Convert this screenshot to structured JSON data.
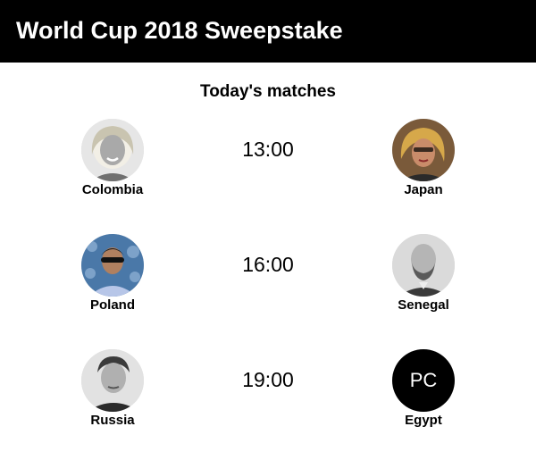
{
  "app": {
    "title": "World Cup 2018 Sweepstake"
  },
  "section": {
    "title": "Today's matches"
  },
  "matches": [
    {
      "time": "13:00",
      "home": {
        "team": "Colombia",
        "avatar": "blonde-woman-photo"
      },
      "away": {
        "team": "Japan",
        "avatar": "woman-red-hair-photo"
      }
    },
    {
      "time": "16:00",
      "home": {
        "team": "Poland",
        "avatar": "man-sunglasses-photo"
      },
      "away": {
        "team": "Senegal",
        "avatar": "bearded-man-photo"
      }
    },
    {
      "time": "19:00",
      "home": {
        "team": "Russia",
        "avatar": "man-portrait-photo"
      },
      "away": {
        "team": "Egypt",
        "avatar_initials": "PC"
      }
    }
  ],
  "colors": {
    "header_bg": "#000000",
    "header_text": "#ffffff",
    "initials_bg": "#000000"
  }
}
